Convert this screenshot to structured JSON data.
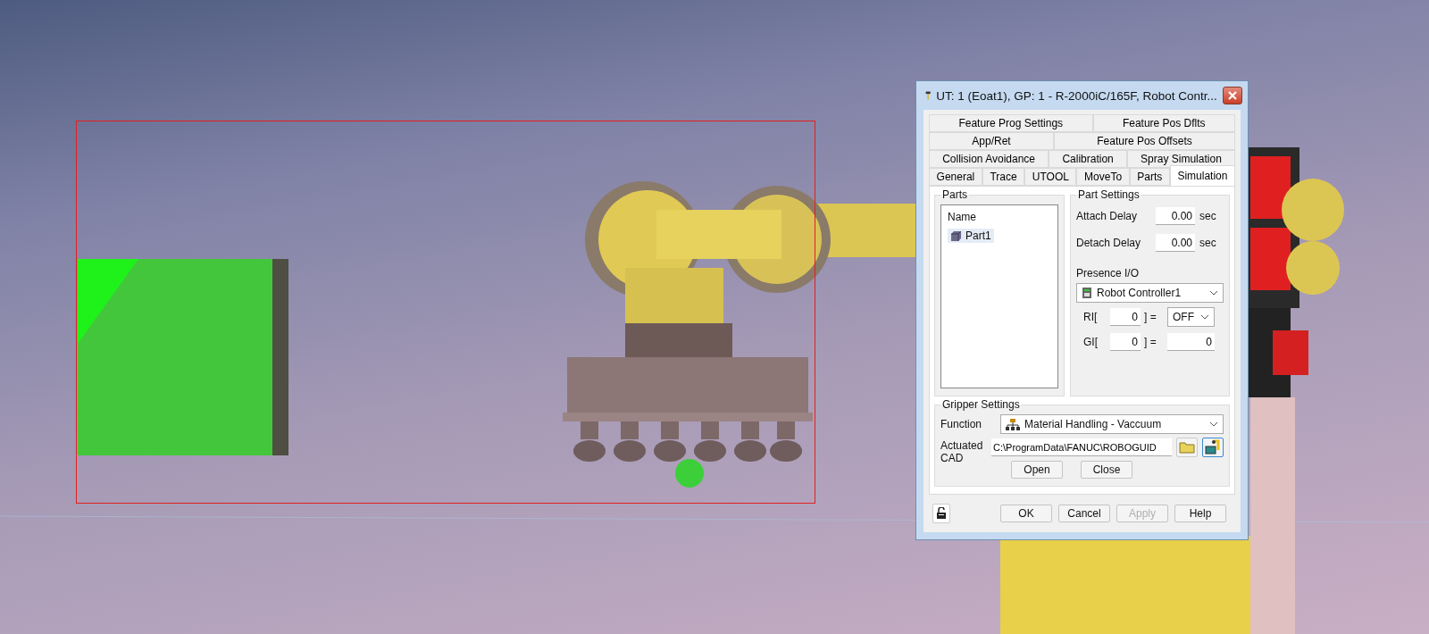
{
  "dialog": {
    "title": "UT: 1  (Eoat1), GP: 1 - R-2000iC/165F, Robot Contr...",
    "tab_rows": [
      {
        "tabs": [
          {
            "label": "Feature Prog Settings",
            "selected": false
          },
          {
            "label": "Feature Pos Dflts",
            "selected": false
          }
        ]
      },
      {
        "tabs": [
          {
            "label": "App/Ret",
            "selected": false
          },
          {
            "label": "Feature Pos Offsets",
            "selected": false
          }
        ]
      },
      {
        "tabs": [
          {
            "label": "Collision Avoidance",
            "selected": false
          },
          {
            "label": "Calibration",
            "selected": false
          },
          {
            "label": "Spray Simulation",
            "selected": false
          }
        ]
      },
      {
        "tabs": [
          {
            "label": "General",
            "selected": false
          },
          {
            "label": "Trace",
            "selected": false
          },
          {
            "label": "UTOOL",
            "selected": false
          },
          {
            "label": "MoveTo",
            "selected": false
          },
          {
            "label": "Parts",
            "selected": false
          },
          {
            "label": "Simulation",
            "selected": true
          }
        ]
      }
    ],
    "parts": {
      "title": "Parts",
      "column": "Name",
      "items": [
        {
          "label": "Part1",
          "selected": true
        }
      ]
    },
    "part_settings": {
      "title": "Part Settings",
      "attach_delay": {
        "label": "Attach Delay",
        "value": "0.00",
        "unit": "sec"
      },
      "detach_delay": {
        "label": "Detach Delay",
        "value": "0.00",
        "unit": "sec"
      },
      "presence_label": "Presence I/O",
      "controller": "Robot Controller1",
      "ri": {
        "label": "RI[",
        "index": "0",
        "eq": "] =",
        "value": "OFF"
      },
      "gi": {
        "label": "GI[",
        "index": "0",
        "eq": "] =",
        "value": "0"
      }
    },
    "gripper": {
      "title": "Gripper Settings",
      "function_label": "Function",
      "function": "Material Handling - Vaccuum",
      "cad_label": "Actuated CAD",
      "cad_path": "C:\\ProgramData\\FANUC\\ROBOGUID",
      "open": "Open",
      "close": "Close"
    },
    "buttons": [
      {
        "label": "OK",
        "disabled": false
      },
      {
        "label": "Cancel",
        "disabled": false
      },
      {
        "label": "Apply",
        "disabled": true
      },
      {
        "label": "Help",
        "disabled": false
      }
    ]
  }
}
